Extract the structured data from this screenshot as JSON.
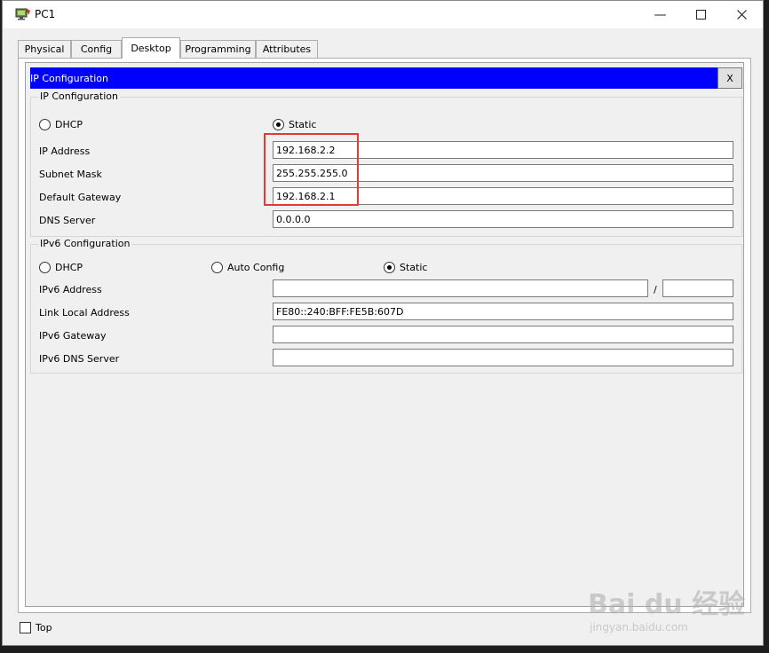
{
  "window": {
    "title": "PC1",
    "minimize_icon": "minimize-icon",
    "maximize_icon": "maximize-icon",
    "close_icon": "close-icon"
  },
  "tabs": [
    {
      "label": "Physical"
    },
    {
      "label": "Config"
    },
    {
      "label": "Desktop",
      "active": true
    },
    {
      "label": "Programming"
    },
    {
      "label": "Attributes"
    }
  ],
  "ip_config": {
    "header": "IP Configuration",
    "close_label": "X",
    "ipv4": {
      "group_title": "IP Configuration",
      "dhcp_label": "DHCP",
      "static_label": "Static",
      "mode": "Static",
      "ip_address_label": "IP Address",
      "ip_address": "192.168.2.2",
      "subnet_mask_label": "Subnet Mask",
      "subnet_mask": "255.255.255.0",
      "default_gateway_label": "Default Gateway",
      "default_gateway": "192.168.2.1",
      "dns_server_label": "DNS Server",
      "dns_server": "0.0.0.0"
    },
    "ipv6": {
      "group_title": "IPv6 Configuration",
      "dhcp_label": "DHCP",
      "auto_config_label": "Auto Config",
      "static_label": "Static",
      "mode": "Static",
      "ipv6_address_label": "IPv6 Address",
      "ipv6_address": "",
      "prefix_separator": "/",
      "prefix_length": "",
      "link_local_label": "Link Local Address",
      "link_local": "FE80::240:BFF:FE5B:607D",
      "ipv6_gateway_label": "IPv6 Gateway",
      "ipv6_gateway": "",
      "ipv6_dns_label": "IPv6 DNS Server",
      "ipv6_dns": ""
    }
  },
  "footer": {
    "top_label": "Top",
    "top_checked": false
  },
  "watermark": {
    "text": "Bai du 经验",
    "sub": "jingyan.baidu.com"
  },
  "colors": {
    "header_bg": "#0000ff",
    "highlight": "#e53935"
  }
}
